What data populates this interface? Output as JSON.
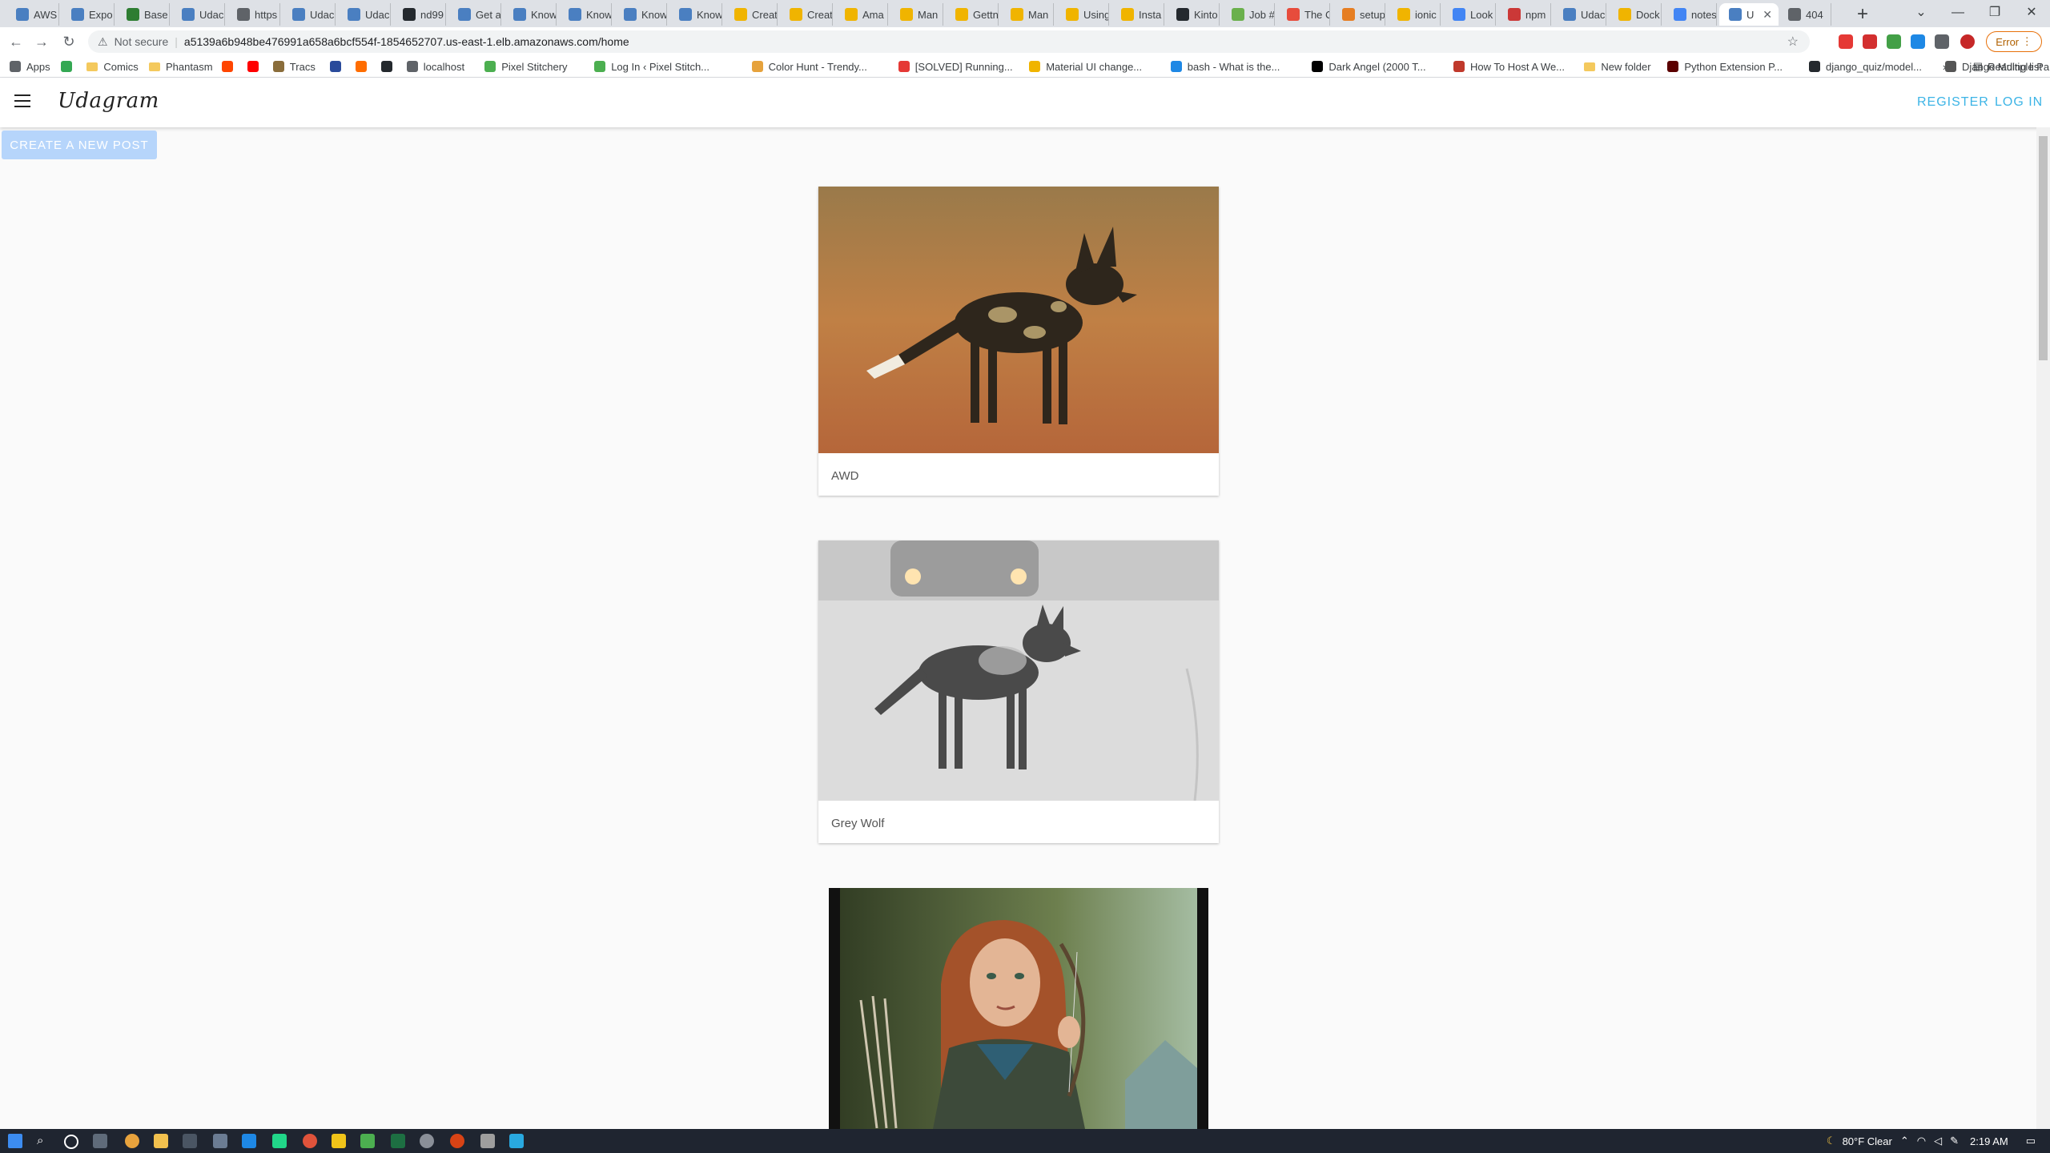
{
  "browser": {
    "tabs": [
      {
        "label": "AWS",
        "color": "#4a7fc1"
      },
      {
        "label": "Expo",
        "color": "#4a7fc1"
      },
      {
        "label": "Base",
        "color": "#2e7d32"
      },
      {
        "label": "Udac",
        "color": "#4a7fc1"
      },
      {
        "label": "https",
        "color": "#5f6368"
      },
      {
        "label": "Udac",
        "color": "#4a7fc1"
      },
      {
        "label": "Udac",
        "color": "#4a7fc1"
      },
      {
        "label": "nd99",
        "color": "#24292e"
      },
      {
        "label": "Get a",
        "color": "#4a7fc1"
      },
      {
        "label": "Know",
        "color": "#4a7fc1"
      },
      {
        "label": "Know",
        "color": "#4a7fc1"
      },
      {
        "label": "Know",
        "color": "#4a7fc1"
      },
      {
        "label": "Know",
        "color": "#4a7fc1"
      },
      {
        "label": "Creat",
        "color": "#f0b400"
      },
      {
        "label": "Creat",
        "color": "#f0b400"
      },
      {
        "label": "Ama",
        "color": "#f0b400"
      },
      {
        "label": "Man",
        "color": "#f0b400"
      },
      {
        "label": "Gettn",
        "color": "#f0b400"
      },
      {
        "label": "Man",
        "color": "#f0b400"
      },
      {
        "label": "Using",
        "color": "#f0b400"
      },
      {
        "label": "Insta",
        "color": "#f0b400"
      },
      {
        "label": "Kinto",
        "color": "#24292e"
      },
      {
        "label": "Job #",
        "color": "#6ab04c"
      },
      {
        "label": "The C",
        "color": "#e74c3c"
      },
      {
        "label": "setup",
        "color": "#e67e22"
      },
      {
        "label": "ionic",
        "color": "#f0b400"
      },
      {
        "label": "Look",
        "color": "#4285f4"
      },
      {
        "label": "npm",
        "color": "#cb3837"
      },
      {
        "label": "Udac",
        "color": "#4a7fc1"
      },
      {
        "label": "Dock",
        "color": "#f0b400"
      },
      {
        "label": "notes",
        "color": "#4285f4"
      },
      {
        "label": "U",
        "color": "#4a7fc1",
        "active": true
      },
      {
        "label": "404",
        "color": "#5f6368"
      }
    ],
    "active_tab_close": "✕",
    "new_tab": "+",
    "window_buttons": [
      "⌄",
      "—",
      "❐",
      "✕"
    ],
    "security_label": "Not secure",
    "url": "a5139a6b948be476991a658a6bcf554f-1854652707.us-east-1.elb.amazonaws.com/home",
    "error_label": "Error",
    "bookmarks": [
      {
        "label": "Apps",
        "type": "apps"
      },
      {
        "label": "",
        "type": "icon",
        "color": "#34a853"
      },
      {
        "label": "Comics",
        "type": "folder"
      },
      {
        "label": "Phantasm",
        "type": "folder"
      },
      {
        "label": "",
        "type": "icon",
        "color": "#ff4500"
      },
      {
        "label": "",
        "type": "icon",
        "color": "#ff0000"
      },
      {
        "label": "Tracs",
        "type": "icon",
        "color": "#8a6d3b"
      },
      {
        "label": "",
        "type": "icon",
        "color": "#2a4b9b"
      },
      {
        "label": "",
        "type": "icon",
        "color": "#ff6d00"
      },
      {
        "label": "",
        "type": "icon",
        "color": "#24292e"
      },
      {
        "label": "localhost",
        "type": "icon",
        "color": "#5f6368"
      },
      {
        "label": "Pixel Stitchery",
        "type": "icon",
        "color": "#4caf50"
      },
      {
        "label": "Log In ‹ Pixel Stitch...",
        "type": "icon",
        "color": "#4caf50"
      },
      {
        "label": "Color Hunt - Trendy...",
        "type": "icon",
        "color": "#e6a23c"
      },
      {
        "label": "[SOLVED] Running...",
        "type": "icon",
        "color": "#e53935"
      },
      {
        "label": "Material UI change...",
        "type": "icon",
        "color": "#f0b400"
      },
      {
        "label": "bash - What is the...",
        "type": "icon",
        "color": "#1e88e5"
      },
      {
        "label": "Dark Angel (2000 T...",
        "type": "icon",
        "color": "#000000"
      },
      {
        "label": "How To Host A We...",
        "type": "icon",
        "color": "#c0392b"
      },
      {
        "label": "New folder",
        "type": "folder"
      },
      {
        "label": "Python Extension P...",
        "type": "icon",
        "color": "#5b0000"
      },
      {
        "label": "django_quiz/model...",
        "type": "icon",
        "color": "#24292e"
      },
      {
        "label": "Django Multiple Pa...",
        "type": "icon",
        "color": "#555555"
      }
    ],
    "bookmarks_overflow": "»",
    "reading_list": "Reading list"
  },
  "app": {
    "brand": "Udagram",
    "register": "REGISTER",
    "login": "LOG IN",
    "create_post": "CREATE A NEW POST"
  },
  "posts": [
    {
      "caption": "AWD",
      "image": "african-wild-dog-photo"
    },
    {
      "caption": "Grey Wolf",
      "image": "grey-wolf-photo"
    },
    {
      "caption": "",
      "image": "archer-painting"
    }
  ],
  "taskbar": {
    "weather": "80°F  Clear",
    "time": "2:19 AM"
  }
}
